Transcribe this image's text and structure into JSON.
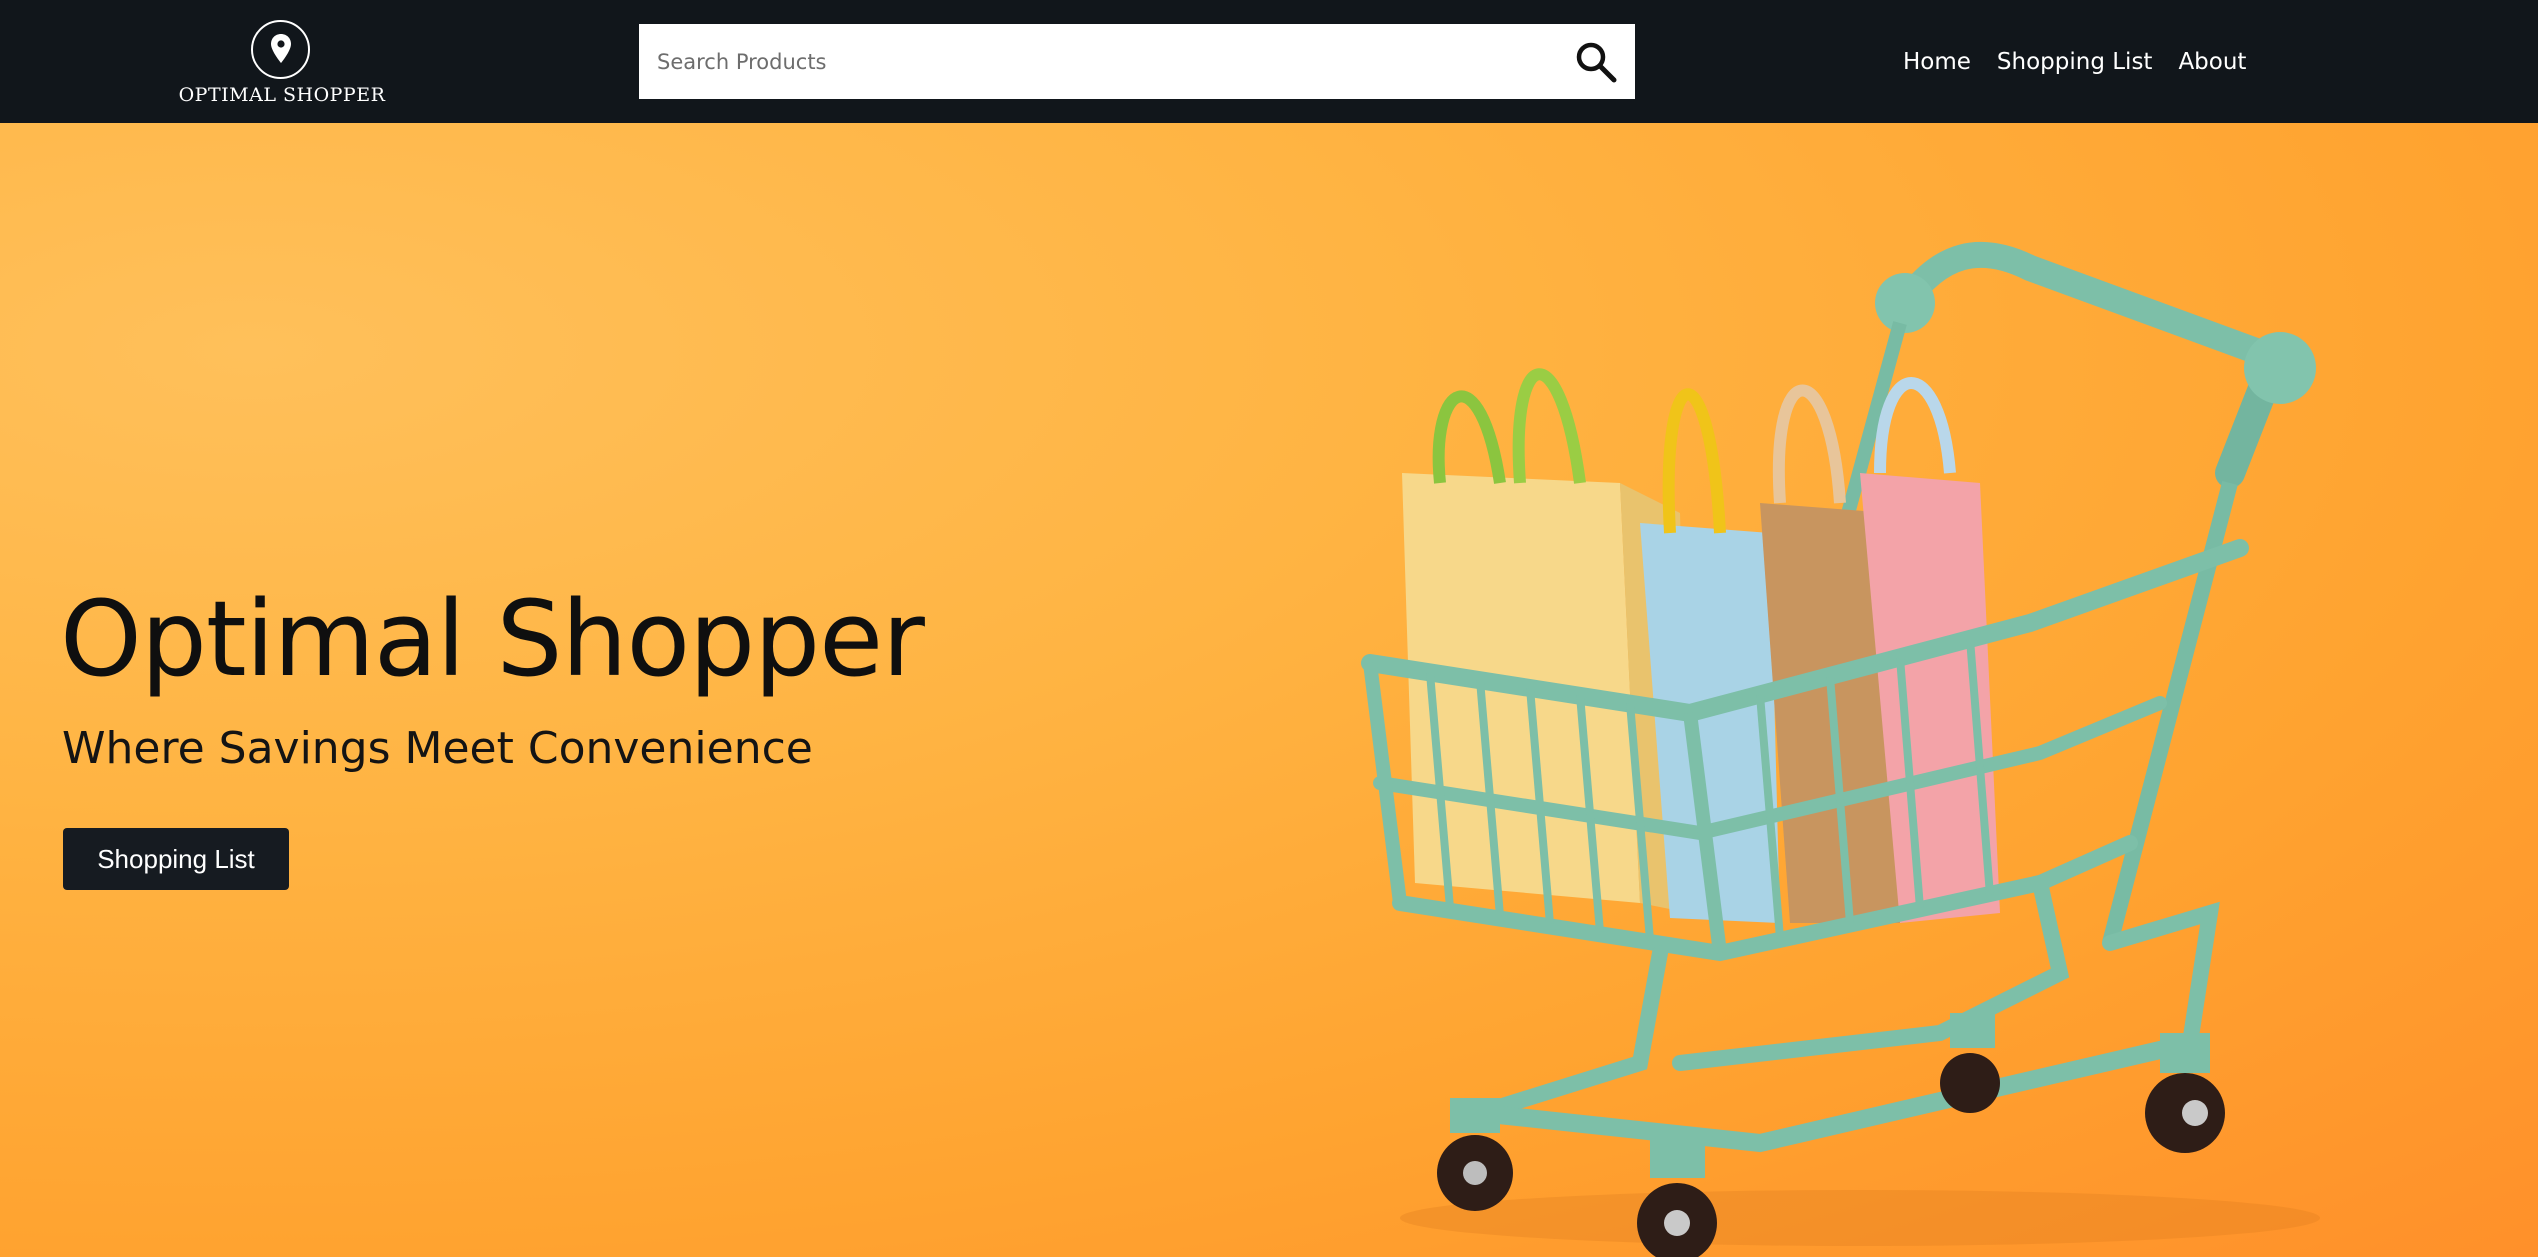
{
  "header": {
    "logo_text": "OPTIMAL SHOPPER",
    "logo_icon": "location-pin-icon",
    "search": {
      "placeholder": "Search Products",
      "value": "",
      "icon": "search-icon"
    },
    "nav": [
      {
        "label": "Home"
      },
      {
        "label": "Shopping List"
      },
      {
        "label": "About"
      }
    ]
  },
  "hero": {
    "title": "Optimal Shopper",
    "subtitle": "Where Savings Meet Convenience",
    "cta_label": "Shopping List",
    "image": "shopping-cart-with-bags"
  },
  "colors": {
    "navbar": "#11161b",
    "hero_background": "#ffad3a",
    "cta_background": "#161b21",
    "cart": "#7dbfa8"
  }
}
